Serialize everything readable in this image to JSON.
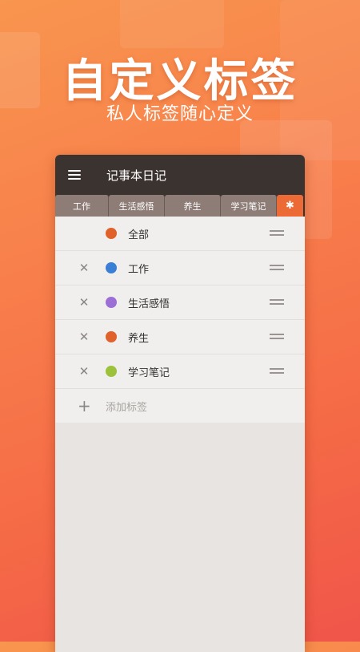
{
  "hero": {
    "title": "自定义标签",
    "subtitle": "私人标签随心定义"
  },
  "appbar": {
    "title": "记事本日记",
    "menu_icon": "hamburger-menu-icon"
  },
  "tabs": [
    {
      "label": "工作"
    },
    {
      "label": "生活感悟"
    },
    {
      "label": "养生"
    },
    {
      "label": "学习笔记"
    }
  ],
  "settings_tab": {
    "icon": "gear-icon",
    "color": "#ec6a35"
  },
  "tags": [
    {
      "label": "全部",
      "color": "#e0612a",
      "deletable": false
    },
    {
      "label": "工作",
      "color": "#3b7ed6",
      "deletable": true
    },
    {
      "label": "生活感悟",
      "color": "#9b6fd6",
      "deletable": true
    },
    {
      "label": "养生",
      "color": "#e0612a",
      "deletable": true
    },
    {
      "label": "学习笔记",
      "color": "#9cc23c",
      "deletable": true
    }
  ],
  "add": {
    "label": "添加标签"
  },
  "symbols": {
    "delete": "✕",
    "add": "+",
    "gear": "✱"
  }
}
